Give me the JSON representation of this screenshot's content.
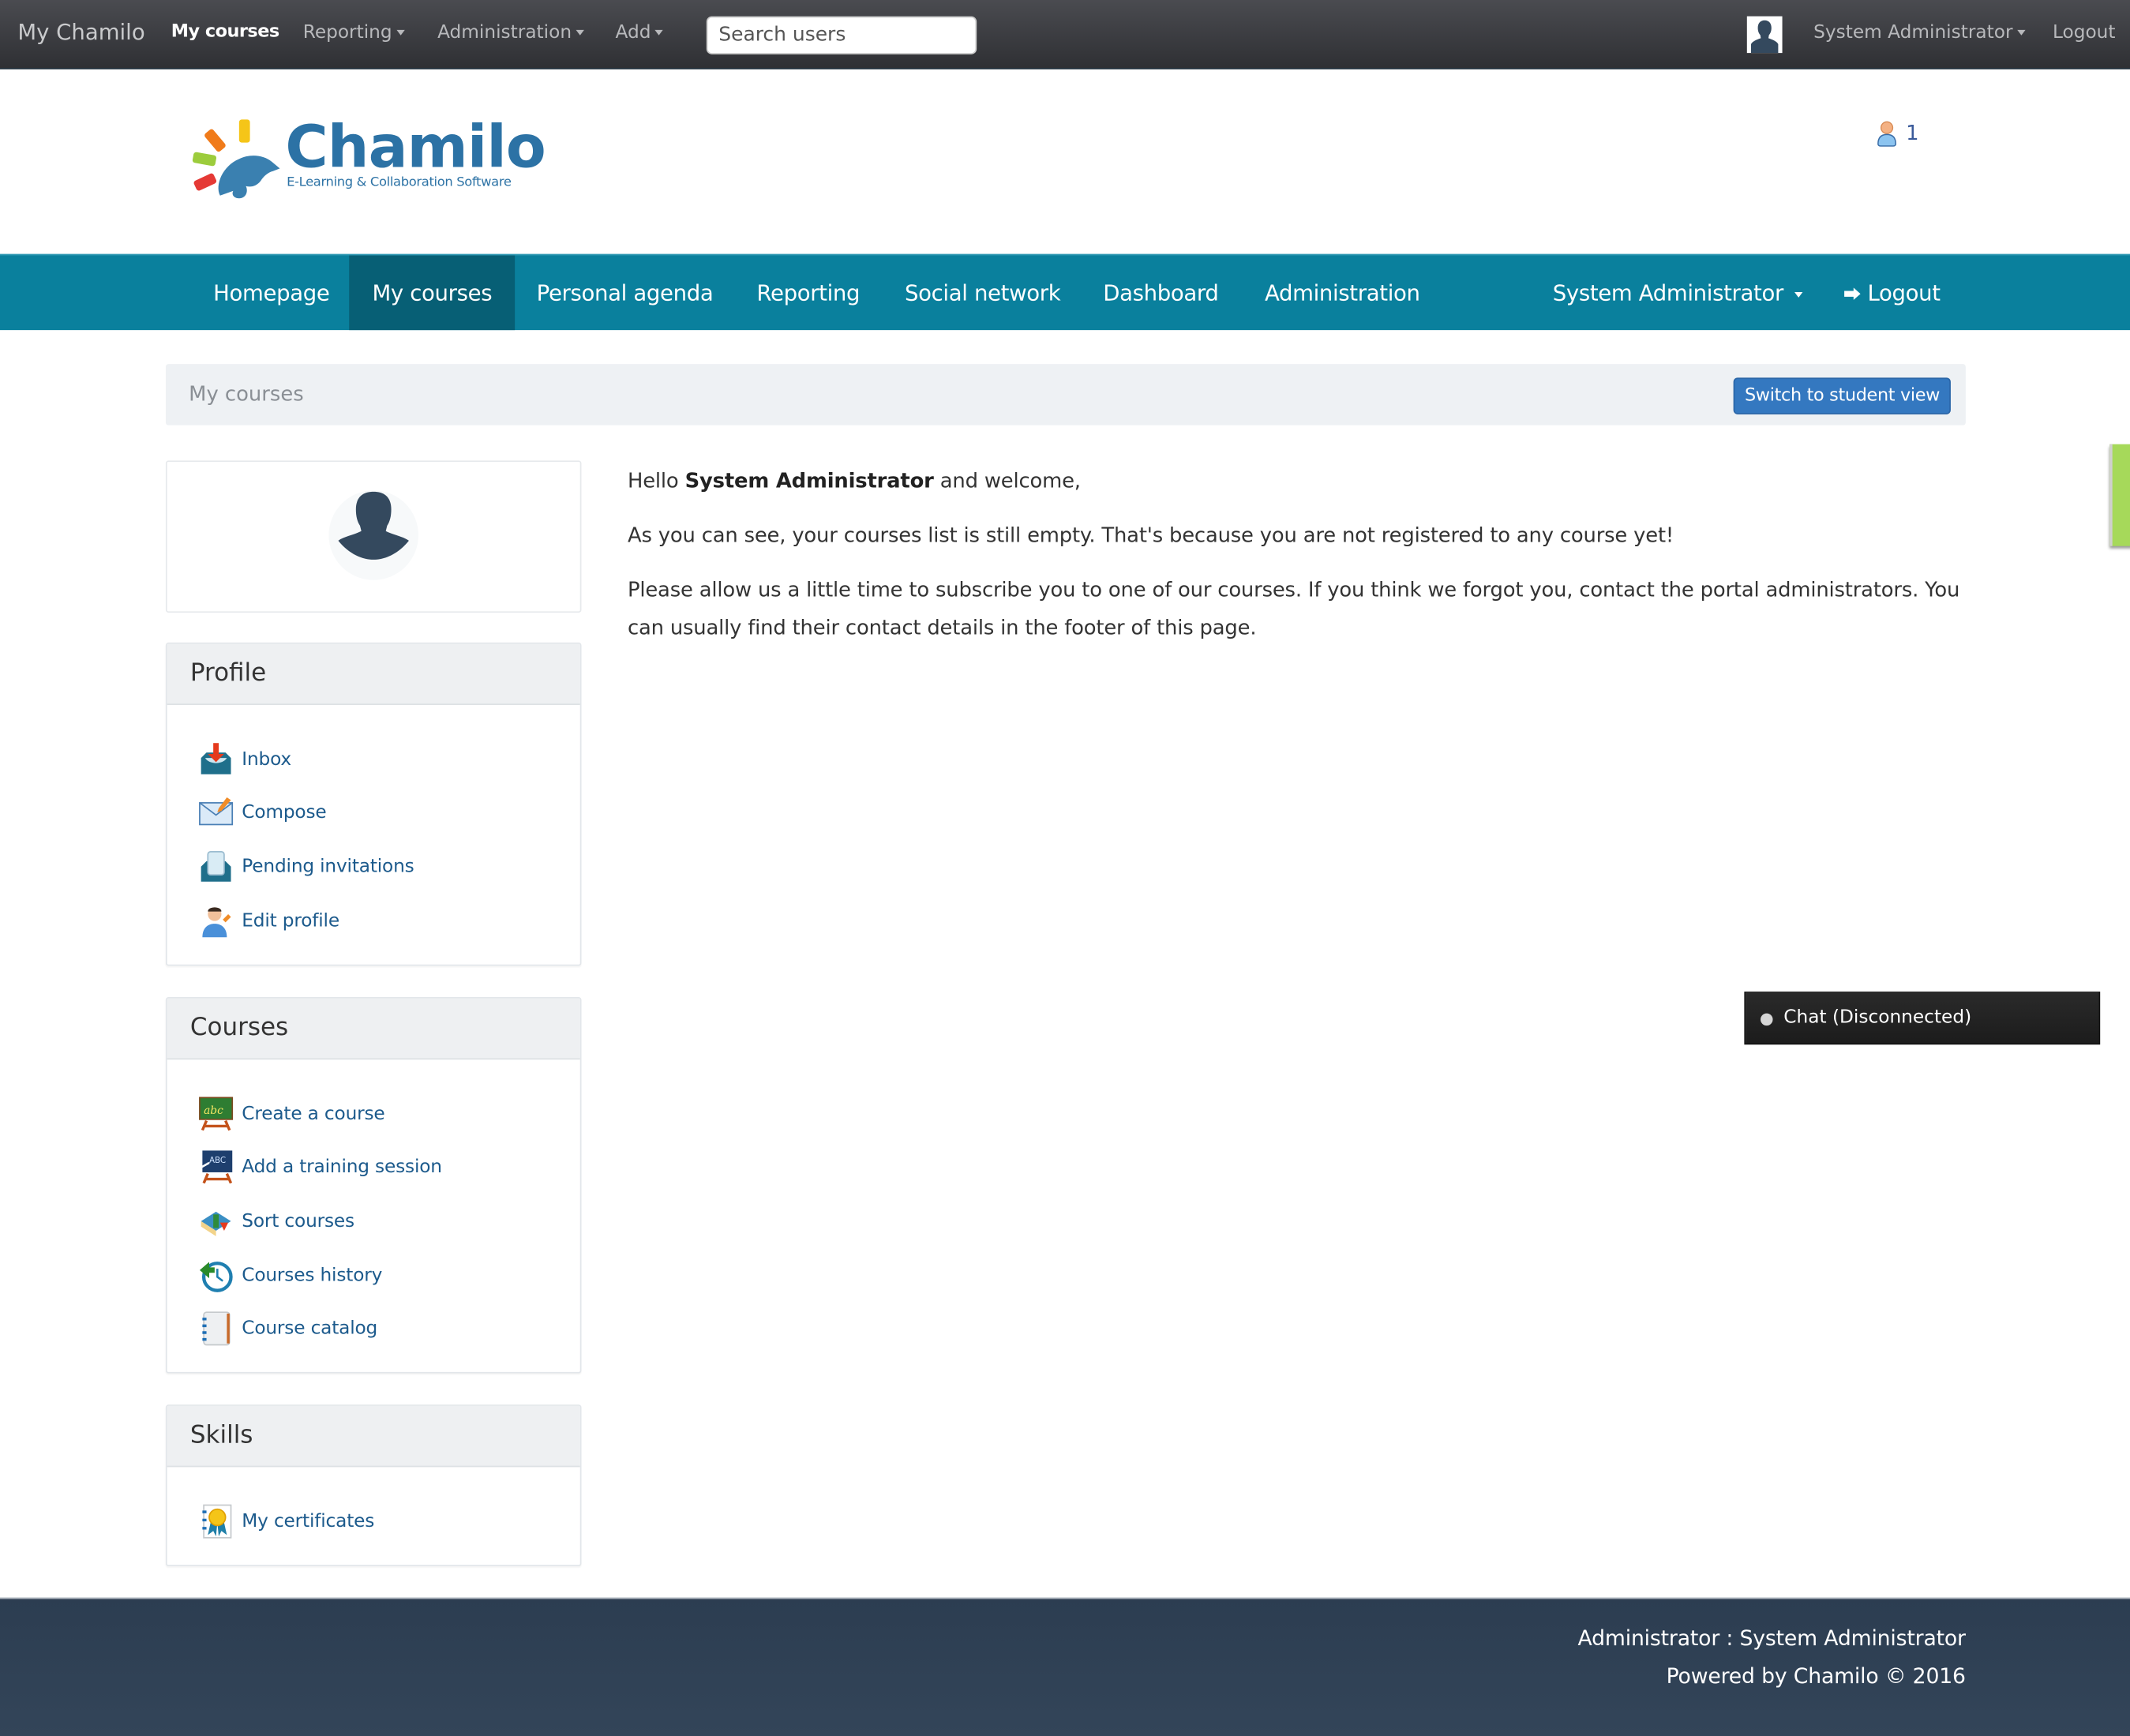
{
  "topbar": {
    "brand": "My Chamilo",
    "items": [
      {
        "label": "My courses",
        "active": true,
        "dropdown": false
      },
      {
        "label": "Reporting",
        "active": false,
        "dropdown": true
      },
      {
        "label": "Administration",
        "active": false,
        "dropdown": true
      },
      {
        "label": "Add",
        "active": false,
        "dropdown": true
      }
    ],
    "search_placeholder": "Search users",
    "user_label": "System Administrator",
    "logout_label": "Logout"
  },
  "header": {
    "logo_title": "Chamilo",
    "logo_subtitle": "E-Learning & Collaboration Software",
    "online_users_count": "1"
  },
  "mainnav": {
    "items": [
      {
        "label": "Homepage",
        "active": false
      },
      {
        "label": "My courses",
        "active": true
      },
      {
        "label": "Personal agenda",
        "active": false
      },
      {
        "label": "Reporting",
        "active": false
      },
      {
        "label": "Social network",
        "active": false
      },
      {
        "label": "Dashboard",
        "active": false
      },
      {
        "label": "Administration",
        "active": false
      }
    ],
    "user_label": "System Administrator",
    "logout_label": "Logout",
    "accent_color": "#0a809d"
  },
  "breadcrumb": {
    "label": "My courses",
    "switch_button": "Switch to student view"
  },
  "sidebar": {
    "profile": {
      "title": "Profile",
      "items": [
        {
          "label": "Inbox",
          "icon": "inbox-icon"
        },
        {
          "label": "Compose",
          "icon": "compose-envelope-icon"
        },
        {
          "label": "Pending invitations",
          "icon": "pending-invitations-icon"
        },
        {
          "label": "Edit profile",
          "icon": "edit-profile-icon"
        }
      ]
    },
    "courses": {
      "title": "Courses",
      "items": [
        {
          "label": "Create a course",
          "icon": "create-course-icon"
        },
        {
          "label": "Add a training session",
          "icon": "training-session-icon"
        },
        {
          "label": "Sort courses",
          "icon": "sort-courses-icon"
        },
        {
          "label": "Courses history",
          "icon": "history-clock-icon"
        },
        {
          "label": "Course catalog",
          "icon": "catalog-book-icon"
        }
      ]
    },
    "skills": {
      "title": "Skills",
      "items": [
        {
          "label": "My certificates",
          "icon": "certificate-icon"
        }
      ]
    }
  },
  "welcome": {
    "hello_prefix": "Hello ",
    "user_name": "System Administrator",
    "hello_suffix": " and welcome,",
    "para1": "As you can see, your courses list is still empty. That's because you are not registered to any course yet!",
    "para2": "Please allow us a little time to subscribe you to one of our courses. If you think we forgot you, contact the portal administrators. You can usually find their contact details in the footer of this page."
  },
  "chat": {
    "label": "Chat (Disconnected)"
  },
  "footer": {
    "admin_line": "Administrator : System Administrator",
    "powered_line": "Powered by Chamilo © 2016"
  }
}
